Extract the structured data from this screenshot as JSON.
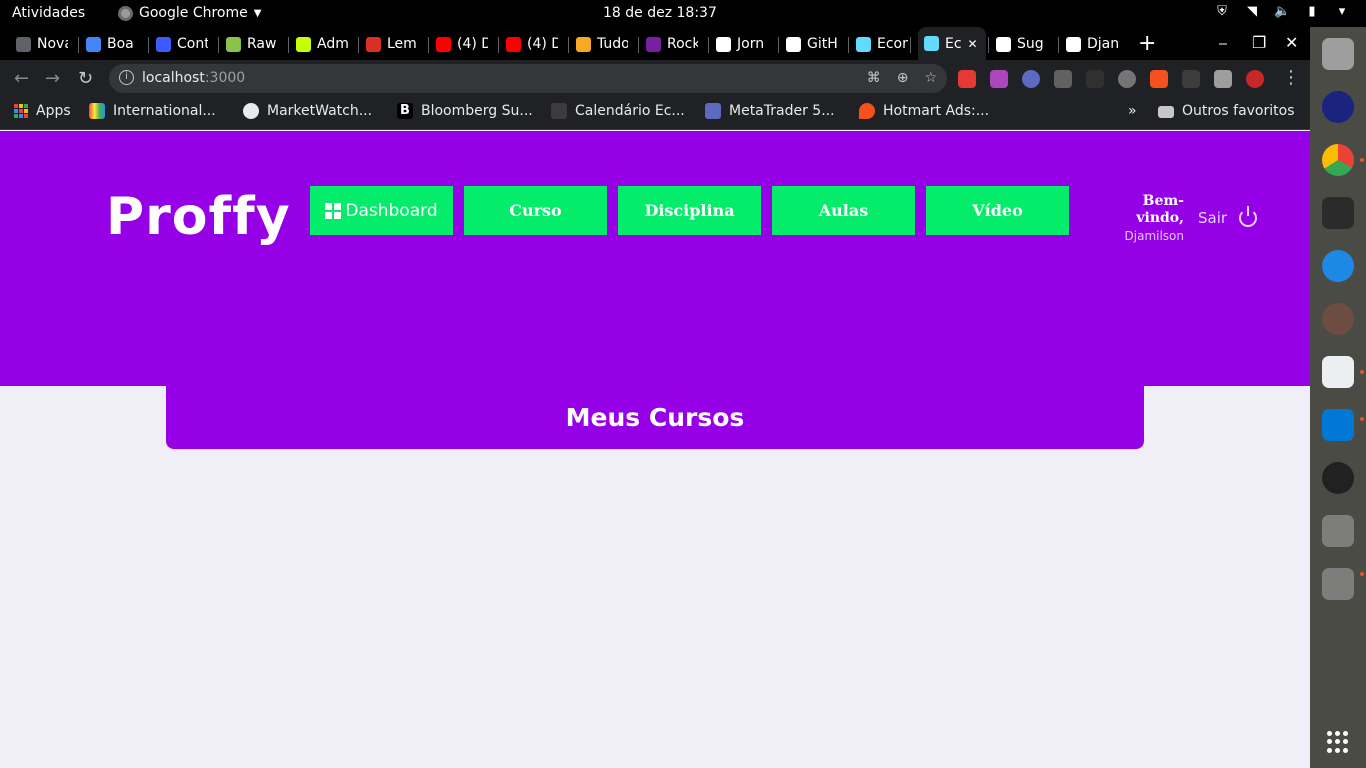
{
  "topbar": {
    "activities": "Atividades",
    "app_name": "Google Chrome",
    "clock": "18 de dez  18:37"
  },
  "tabs": [
    {
      "label": "Nova gu",
      "color": "#5f6368"
    },
    {
      "label": "Boa",
      "color": "#4285f4"
    },
    {
      "label": "Cont",
      "color": "#3d5afe"
    },
    {
      "label": "Raw",
      "color": "#8bc34a"
    },
    {
      "label": "Adm",
      "color": "#c6ff00"
    },
    {
      "label": "Lem",
      "color": "#d93025"
    },
    {
      "label": "(4) D",
      "color": "#ff0000"
    },
    {
      "label": "(4) D",
      "color": "#ff0000"
    },
    {
      "label": "Tudo",
      "color": "#f9a825"
    },
    {
      "label": "Rock",
      "color": "#7b1fa2"
    },
    {
      "label": "Jorn",
      "color": "#ffffff"
    },
    {
      "label": "GitH",
      "color": "#ffffff"
    },
    {
      "label": "Econ",
      "color": "#61dafb"
    },
    {
      "label": "Ec",
      "color": "#61dafb",
      "active": true
    },
    {
      "label": "Sug",
      "color": "#ffffff"
    },
    {
      "label": "Djan",
      "color": "#ffffff"
    }
  ],
  "omnibox": {
    "host": "localhost",
    "port": ":3000"
  },
  "bookmarks": [
    {
      "label": "Apps"
    },
    {
      "label": "International..."
    },
    {
      "label": "MarketWatch..."
    },
    {
      "label": "Bloomberg Su..."
    },
    {
      "label": "Calendário Ec..."
    },
    {
      "label": "MetaTrader 5..."
    },
    {
      "label": "Hotmart Ads:..."
    }
  ],
  "bookmarks_overflow": "»",
  "other_bookmarks": "Outros favoritos",
  "header": {
    "logo": "Proffy",
    "nav": [
      {
        "label": "Dashboard",
        "icon": "dashboard-icon"
      },
      {
        "label": "Curso"
      },
      {
        "label": "Disciplina"
      },
      {
        "label": "Aulas"
      },
      {
        "label": "Vídeo"
      }
    ],
    "welcome": "Bem-vindo,",
    "username": "Djamilson",
    "logout": "Sair"
  },
  "main": {
    "title": "Meus Cursos"
  },
  "colors": {
    "brand_purple": "#9500e7",
    "accent_green": "#04ec6a",
    "page_bg": "#f0eff7"
  }
}
